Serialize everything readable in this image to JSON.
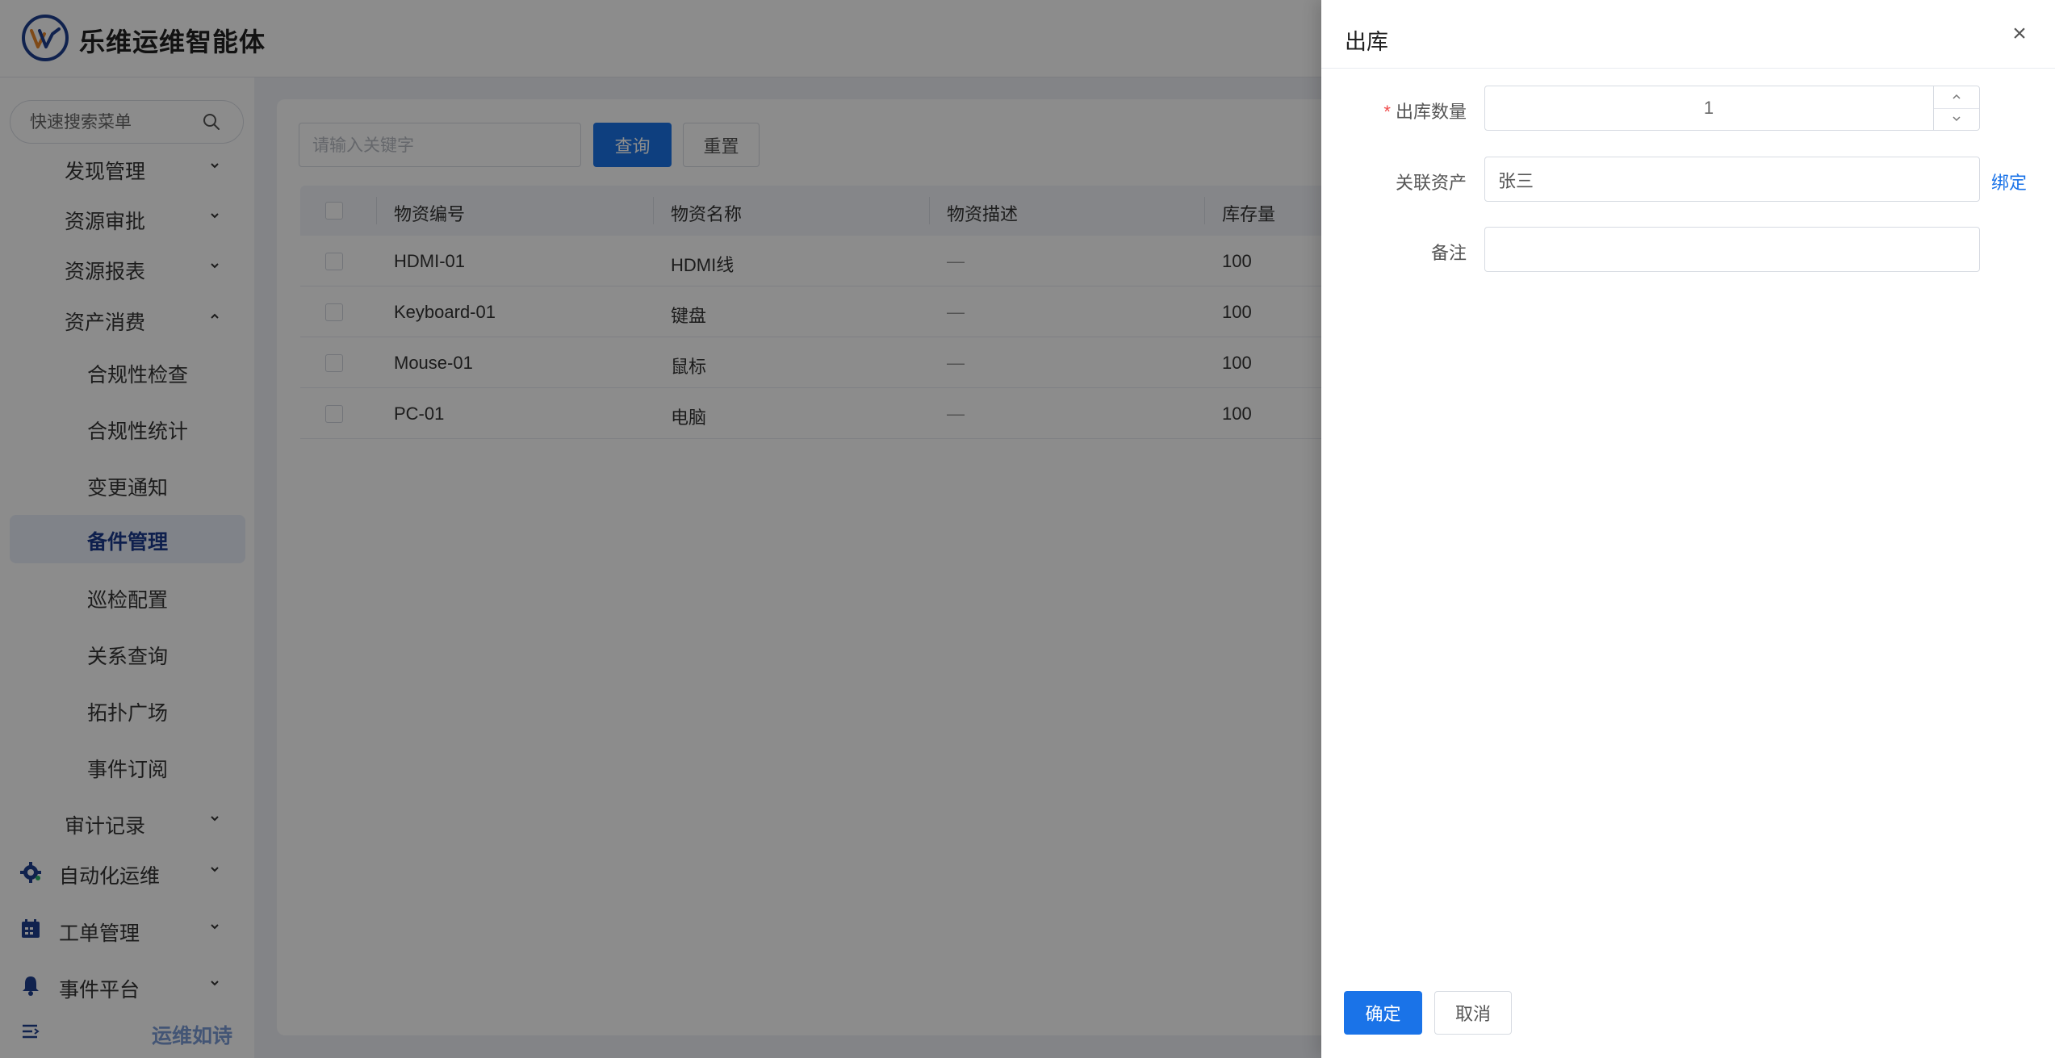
{
  "header": {
    "app_title": "乐维运维智能体"
  },
  "sidebar": {
    "search_placeholder": "快速搜索菜单",
    "groups": [
      {
        "label": "发现管理",
        "expanded": false
      },
      {
        "label": "资源审批",
        "expanded": false
      },
      {
        "label": "资源报表",
        "expanded": false
      },
      {
        "label": "资产消费",
        "expanded": true
      }
    ],
    "sub_items": [
      "合规性检查",
      "合规性统计",
      "变更通知",
      "备件管理",
      "巡检配置",
      "关系查询",
      "拓扑广场",
      "事件订阅"
    ],
    "active_item": "备件管理",
    "audit": {
      "label": "审计记录"
    },
    "top_modules": [
      {
        "label": "自动化运维",
        "icon": "gear-icon"
      },
      {
        "label": "工单管理",
        "icon": "calendar-icon"
      },
      {
        "label": "事件平台",
        "icon": "bell-icon"
      }
    ],
    "footer_text": "运维如诗"
  },
  "toolbar": {
    "keyword_placeholder": "请输入关键字",
    "query_label": "查询",
    "reset_label": "重置"
  },
  "table": {
    "columns": [
      "物资编号",
      "物资名称",
      "物资描述",
      "库存量"
    ],
    "rows": [
      {
        "code": "HDMI-01",
        "name": "HDMI线",
        "desc": "—",
        "stock": "100"
      },
      {
        "code": "Keyboard-01",
        "name": "键盘",
        "desc": "—",
        "stock": "100"
      },
      {
        "code": "Mouse-01",
        "name": "鼠标",
        "desc": "—",
        "stock": "100"
      },
      {
        "code": "PC-01",
        "name": "电脑",
        "desc": "—",
        "stock": "100"
      }
    ]
  },
  "drawer": {
    "title": "出库",
    "close": "×",
    "fields": {
      "quantity_label": "出库数量",
      "quantity_value": "1",
      "asset_label": "关联资产",
      "asset_value": "张三",
      "bind_link": "绑定",
      "remark_label": "备注",
      "remark_value": ""
    },
    "ok_label": "确定",
    "cancel_label": "取消"
  },
  "colors": {
    "primary": "#1a73e8",
    "brand_dark": "#1e3f8f",
    "required": "#f04b4b",
    "active_bg": "#e9eef9"
  }
}
